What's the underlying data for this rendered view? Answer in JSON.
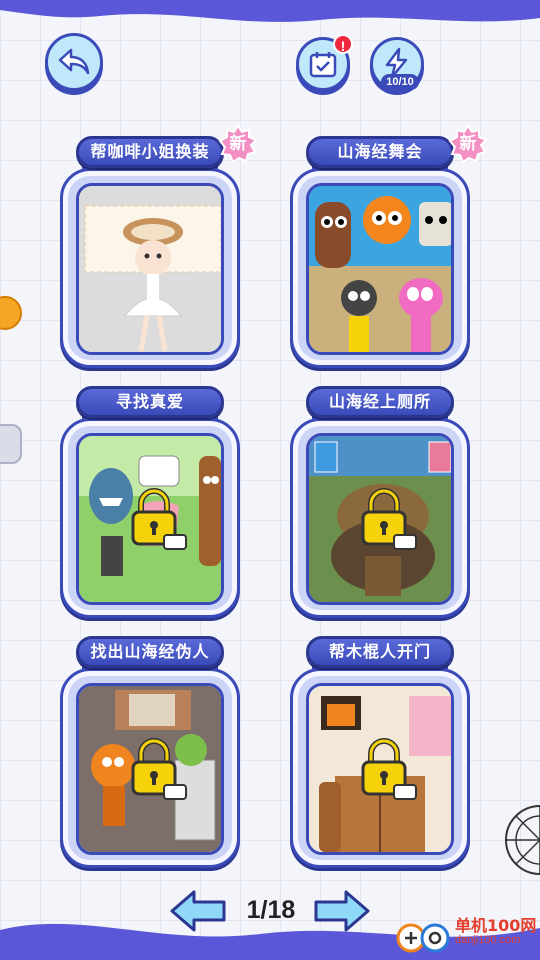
{
  "header": {
    "energy_count": "10/10",
    "calendar_badge": "!"
  },
  "cards": [
    {
      "title": "帮咖啡小姐换装",
      "badge": "新",
      "locked": false
    },
    {
      "title": "山海经舞会",
      "badge": "新",
      "locked": false
    },
    {
      "title": "寻找真爱",
      "badge": "",
      "locked": true
    },
    {
      "title": "山海经上厕所",
      "badge": "",
      "locked": true
    },
    {
      "title": "找出山海经伪人",
      "badge": "",
      "locked": true
    },
    {
      "title": "帮木棍人开门",
      "badge": "",
      "locked": true
    }
  ],
  "pager": {
    "label": "1/18",
    "current": 1,
    "total": 18
  },
  "watermark": {
    "name": "单机100网",
    "url": "danji100.com"
  },
  "colors": {
    "frame": "#3a4ab8",
    "frame_fill": "#cdd5f7",
    "new_badge": "#f48fc4",
    "lock": "#f5d20a",
    "background": "#f4f5fb"
  }
}
